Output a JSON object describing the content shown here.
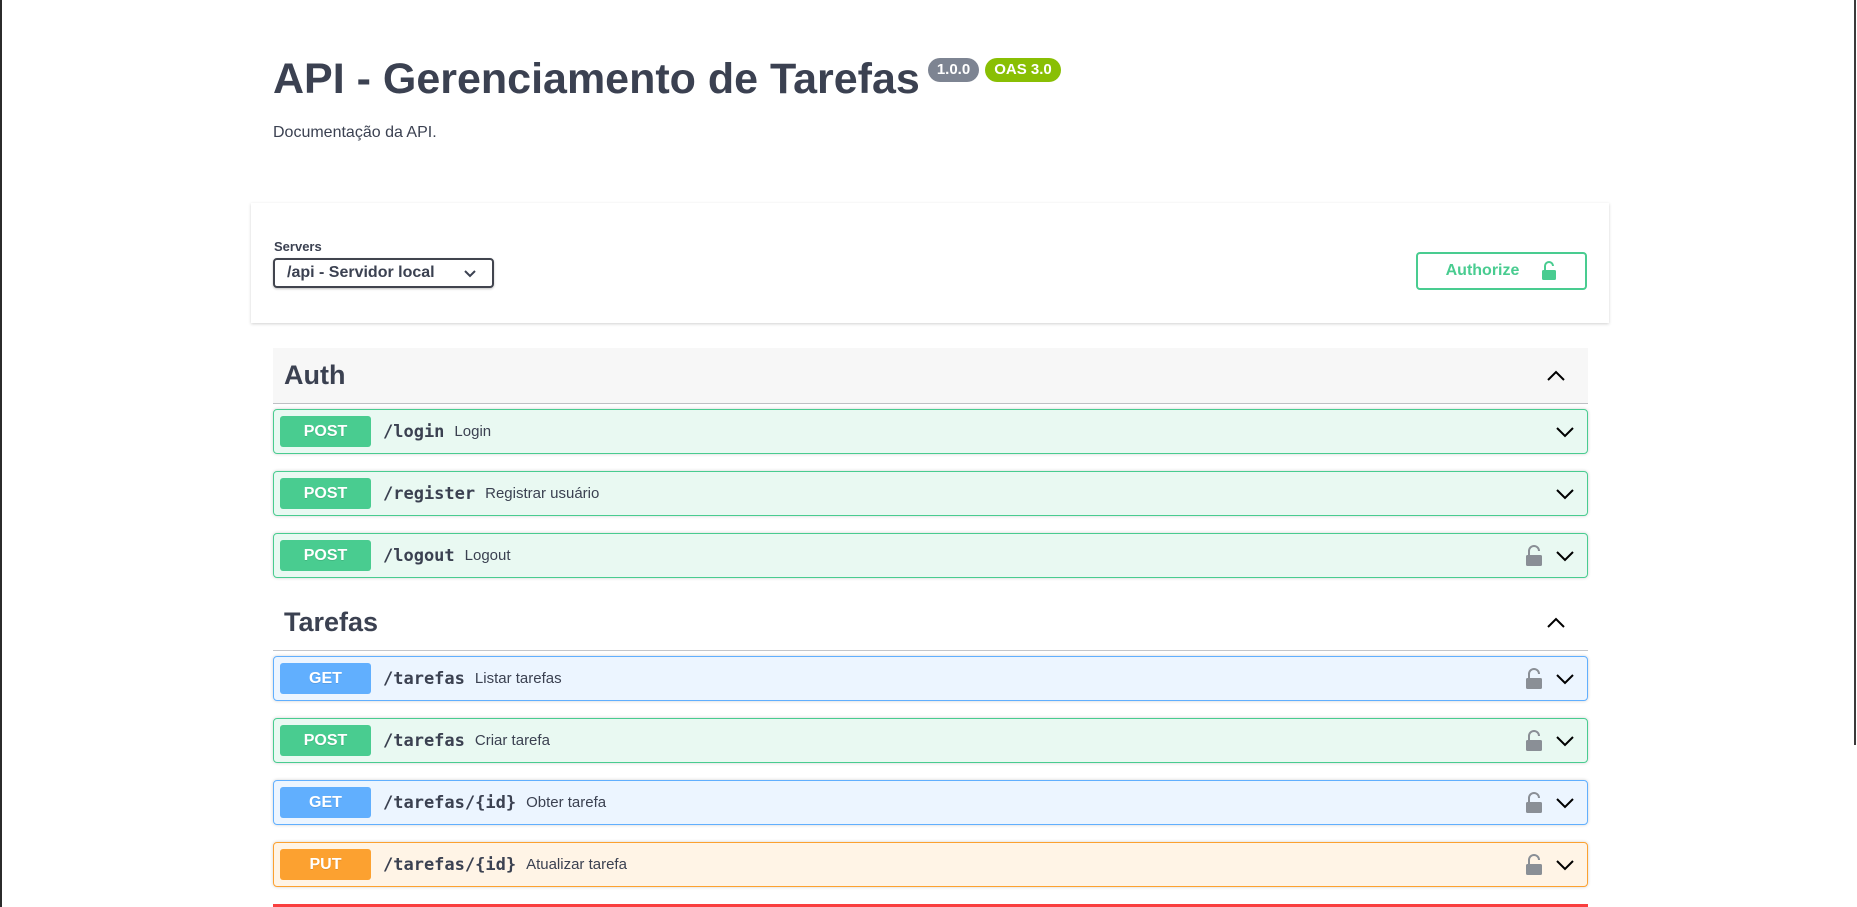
{
  "info": {
    "title": "API - Gerenciamento de Tarefas",
    "version": "1.0.0",
    "oas_version": "OAS 3.0",
    "description": "Documentação da API."
  },
  "servers": {
    "label": "Servers",
    "selected": "/api - Servidor local"
  },
  "authorize": {
    "label": "Authorize",
    "icon": "unlock-icon"
  },
  "tags": [
    {
      "name": "Auth",
      "expanded": true,
      "operations": [
        {
          "method": "POST",
          "path": "/login",
          "summary": "Login",
          "secured": false
        },
        {
          "method": "POST",
          "path": "/register",
          "summary": "Registrar usuário",
          "secured": false
        },
        {
          "method": "POST",
          "path": "/logout",
          "summary": "Logout",
          "secured": true
        }
      ]
    },
    {
      "name": "Tarefas",
      "expanded": true,
      "operations": [
        {
          "method": "GET",
          "path": "/tarefas",
          "summary": "Listar tarefas",
          "secured": true
        },
        {
          "method": "POST",
          "path": "/tarefas",
          "summary": "Criar tarefa",
          "secured": true
        },
        {
          "method": "GET",
          "path": "/tarefas/{id}",
          "summary": "Obter tarefa",
          "secured": true
        },
        {
          "method": "PUT",
          "path": "/tarefas/{id}",
          "summary": "Atualizar tarefa",
          "secured": true
        }
      ]
    }
  ],
  "colors": {
    "post": "#49cc90",
    "get": "#61affe",
    "put": "#fca130",
    "delete": "#f93e3e",
    "version_badge": "#7d8492",
    "oas_badge": "#89bf04"
  }
}
